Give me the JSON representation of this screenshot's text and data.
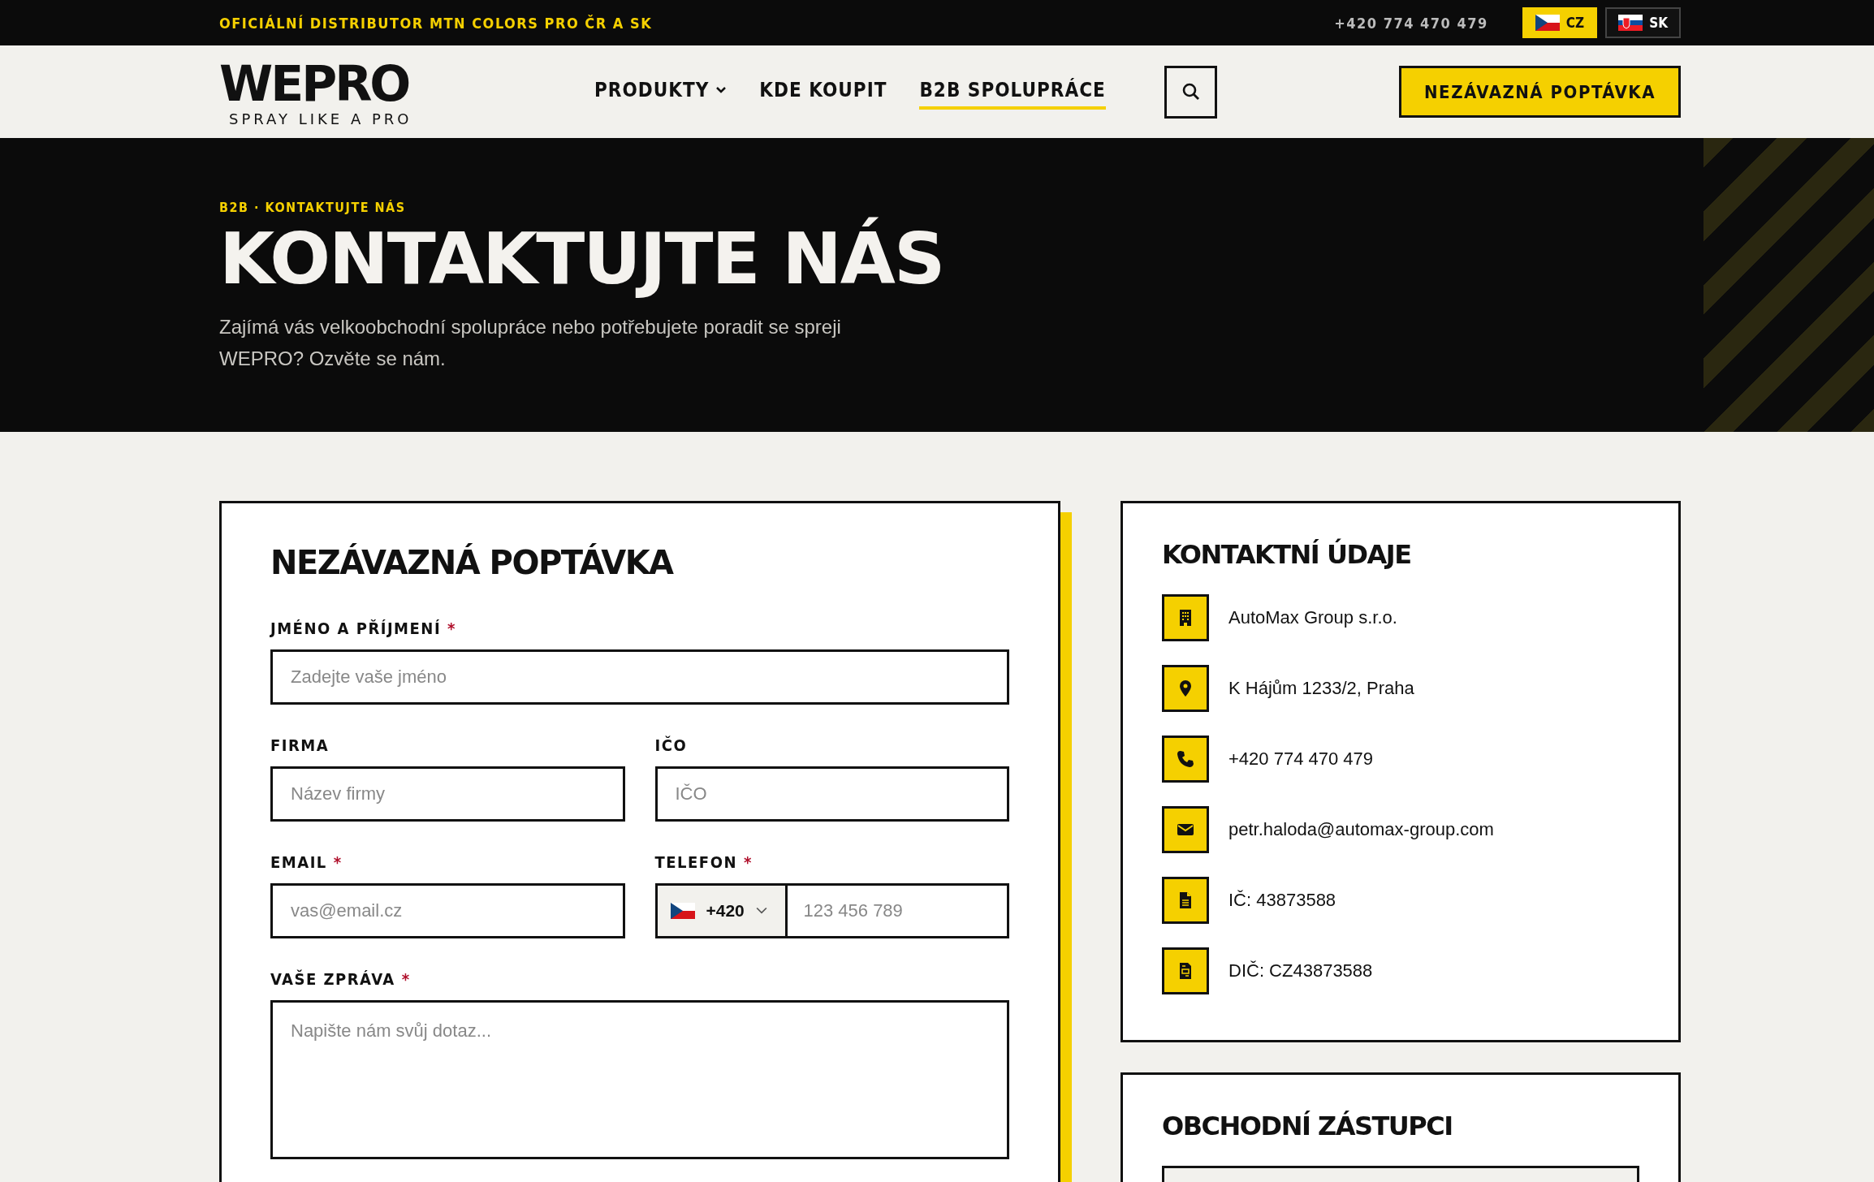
{
  "top_bar": {
    "text": "OFICIÁLNÍ DISTRIBUTOR MTN COLORS PRO ČR A SK",
    "phone": "+420 774 470 479",
    "languages": [
      {
        "code": "CZ",
        "kind": "cz",
        "selected": true
      },
      {
        "code": "SK",
        "kind": "sk",
        "selected": false
      }
    ]
  },
  "header": {
    "logo": {
      "name": "WEPRO",
      "tagline": "SPRAY LIKE A PRO"
    },
    "nav": [
      {
        "label": "PRODUKTY",
        "has_dropdown": true,
        "selected": false
      },
      {
        "label": "KDE KOUPIT",
        "has_dropdown": false,
        "selected": false
      },
      {
        "label": "B2B SPOLUPRÁCE",
        "has_dropdown": false,
        "selected": true
      }
    ],
    "cta": "NEZÁVAZNÁ POPTÁVKA"
  },
  "hero": {
    "breadcrumb": "B2B · KONTAKTUJTE NÁS",
    "title": "KONTAKTUJTE NÁS",
    "description": "Zajímá vás velkoobchodní spolupráce nebo potřebujete poradit se spreji WEPRO? Ozvěte se nám."
  },
  "form": {
    "title": "NEZÁVAZNÁ POPTÁVKA",
    "required_mark": "*",
    "rows": [
      [
        {
          "label": "JMÉNO A PŘÍJMENÍ",
          "required": true,
          "kind": "text",
          "placeholder": "Zadejte vaše jméno"
        }
      ],
      [
        {
          "label": "FIRMA",
          "required": false,
          "kind": "text",
          "placeholder": "Název firmy"
        },
        {
          "label": "IČO",
          "required": false,
          "kind": "text",
          "placeholder": "IČO"
        }
      ],
      [
        {
          "label": "EMAIL",
          "required": true,
          "kind": "text",
          "placeholder": "vas@email.cz"
        },
        {
          "label": "TELEFON",
          "required": true,
          "kind": "phone",
          "prefix": {
            "kind": "cz",
            "code": "+420"
          },
          "placeholder": "123 456 789"
        }
      ],
      [
        {
          "label": "VAŠE ZPRÁVA",
          "required": true,
          "kind": "textarea",
          "placeholder": "Napište nám svůj dotaz..."
        }
      ]
    ]
  },
  "contact": {
    "title": "KONTAKTNÍ ÚDAJE",
    "items": [
      {
        "kind": "building",
        "text": "AutoMax Group s.r.o."
      },
      {
        "kind": "pin",
        "text": "K Hájům 1233/2, Praha"
      },
      {
        "kind": "phone",
        "text": "+420 774 470 479"
      },
      {
        "kind": "mail",
        "text": "petr.haloda@automax-group.com"
      },
      {
        "kind": "document",
        "text": "IČ: 43873588"
      },
      {
        "kind": "receipt",
        "text": "DIČ: CZ43873588"
      }
    ]
  },
  "representatives": {
    "title": "OBCHODNÍ ZÁSTUPCI"
  }
}
